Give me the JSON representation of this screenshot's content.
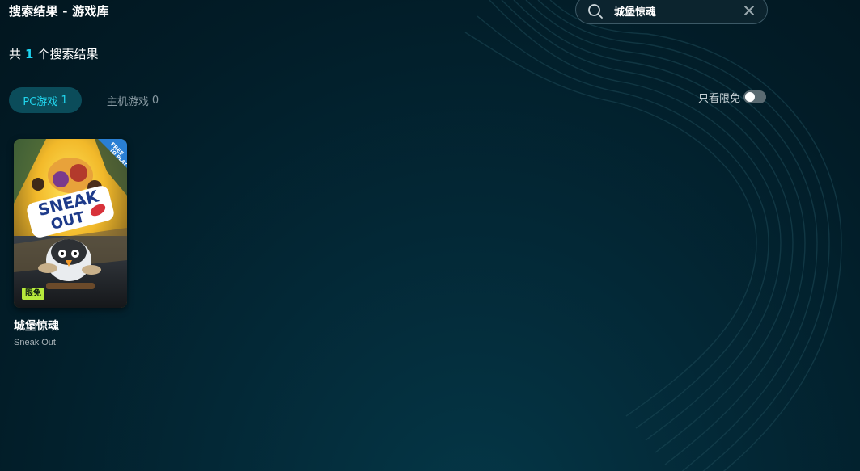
{
  "header": {
    "title": "搜索结果 - 游戏库"
  },
  "search": {
    "value": "城堡惊魂",
    "placeholder": ""
  },
  "results": {
    "prefix": "共",
    "count": "1",
    "suffix": "个搜索结果"
  },
  "tabs": [
    {
      "label": "PC游戏",
      "count": "1",
      "active": true
    },
    {
      "label": "主机游戏",
      "count": "0",
      "active": false
    }
  ],
  "filter": {
    "label": "只看限免",
    "enabled": false
  },
  "games": [
    {
      "title": "城堡惊魂",
      "subtitle": "Sneak Out",
      "badge": "限免",
      "cover_logo_line1": "SNEAK",
      "cover_logo_line2": "OUT",
      "cover_ribbon_line1": "FREE",
      "cover_ribbon_line2": "TO PLAY"
    }
  ],
  "colors": {
    "accent": "#1ed3ef",
    "badge": "#b7ea3c",
    "background": "#032836"
  },
  "icons": {
    "search": "search-icon",
    "clear": "close-icon"
  }
}
